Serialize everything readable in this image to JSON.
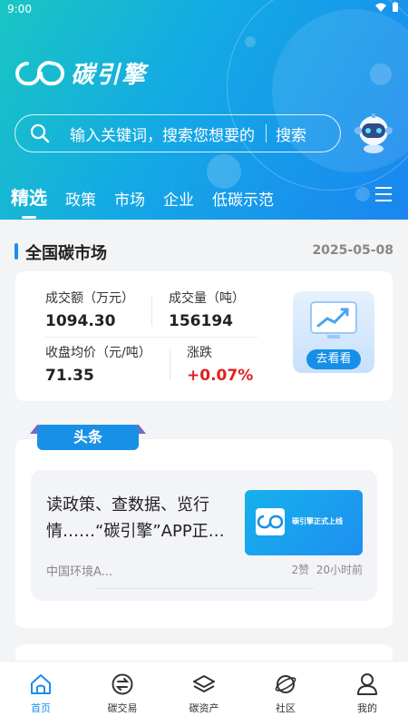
{
  "status_bar": {
    "time": "9:00"
  },
  "app": {
    "logo_text": "碳引擎"
  },
  "search": {
    "placeholder": "输入关键词，搜索您想要的",
    "button_label": "搜索"
  },
  "tabs": [
    {
      "label": "精选",
      "active": true
    },
    {
      "label": "政策"
    },
    {
      "label": "市场"
    },
    {
      "label": "企业"
    },
    {
      "label": "低碳示范"
    }
  ],
  "market": {
    "title": "全国碳市场",
    "date": "2025-05-08",
    "turnover_label": "成交额（万元）",
    "turnover_value": "1094.30",
    "volume_label": "成交量（吨）",
    "volume_value": "156194",
    "avg_price_label": "收盘均价（元/吨）",
    "avg_price_value": "71.35",
    "change_label": "涨跌",
    "change_value": "+0.07%",
    "promo_button": "去看看"
  },
  "headline": {
    "ribbon_label": "头条",
    "items": [
      {
        "title": "读政策、查数据、览行情……“碳引擎”APP正…",
        "source": "中国环境A...",
        "likes": "2赞",
        "time": "20小时前",
        "thumb_text": "碳引擎正式上线"
      }
    ]
  },
  "bottom_nav": [
    {
      "label": "首页",
      "icon": "home-icon",
      "active": true
    },
    {
      "label": "碳交易",
      "icon": "exchange-icon"
    },
    {
      "label": "碳资产",
      "icon": "layers-icon"
    },
    {
      "label": "社区",
      "icon": "planet-icon"
    },
    {
      "label": "我的",
      "icon": "user-icon"
    }
  ],
  "colors": {
    "accent": "#1a8df0",
    "up": "#e02020",
    "header_start": "#19c6c2",
    "header_end": "#1a86f0"
  }
}
